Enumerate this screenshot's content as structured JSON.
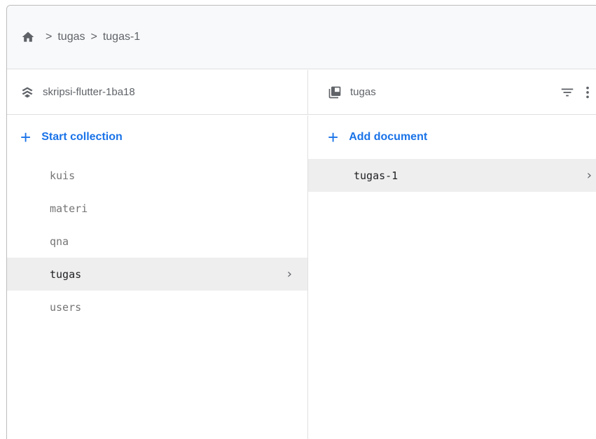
{
  "breadcrumb": {
    "home_icon": "home-icon",
    "items": [
      "tugas",
      "tugas-1"
    ],
    "separator": ">"
  },
  "project_panel": {
    "icon": "firestore-icon",
    "title": "skripsi-flutter-1ba18",
    "add_label": "Start collection",
    "collections": [
      {
        "label": "kuis",
        "selected": false
      },
      {
        "label": "materi",
        "selected": false
      },
      {
        "label": "qna",
        "selected": false
      },
      {
        "label": "tugas",
        "selected": true
      },
      {
        "label": "users",
        "selected": false
      }
    ]
  },
  "collection_panel": {
    "icon": "collection-icon",
    "title": "tugas",
    "add_label": "Add document",
    "documents": [
      {
        "label": "tugas-1",
        "selected": true
      }
    ]
  },
  "colors": {
    "accent": "#1a73e8",
    "selected_bg": "#eeeeee"
  }
}
